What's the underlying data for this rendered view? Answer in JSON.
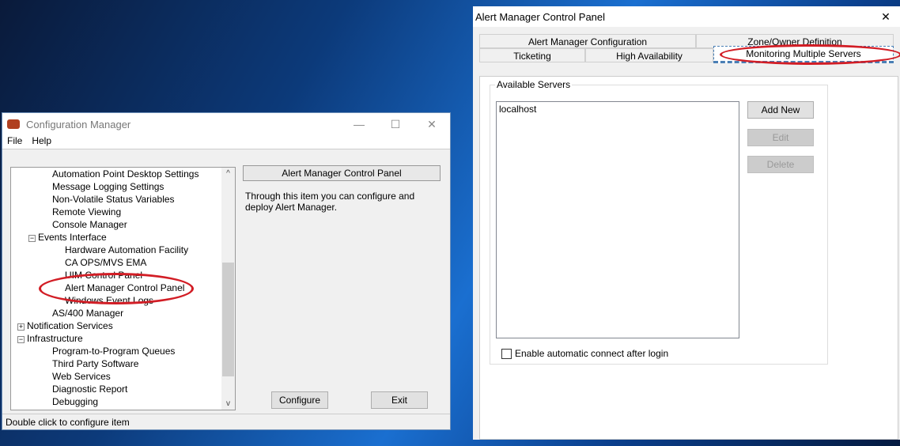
{
  "config_manager": {
    "title": "Configuration Manager",
    "menu": [
      "File",
      "Help"
    ],
    "tree": [
      {
        "label": "Automation Point Desktop Settings",
        "level": 2
      },
      {
        "label": "Message Logging Settings",
        "level": 2
      },
      {
        "label": "Non-Volatile Status Variables",
        "level": 2
      },
      {
        "label": "Remote Viewing",
        "level": 2
      },
      {
        "label": "Console Manager",
        "level": 2
      },
      {
        "label": "Events Interface",
        "level": 2,
        "expander": "−"
      },
      {
        "label": "Hardware Automation Facility",
        "level": 3
      },
      {
        "label": "CA OPS/MVS EMA",
        "level": 3
      },
      {
        "label": "UIM Control Panel",
        "level": 3
      },
      {
        "label": "Alert Manager Control Panel",
        "level": 3
      },
      {
        "label": "Windows Event Logs",
        "level": 3
      },
      {
        "label": "AS/400 Manager",
        "level": 2
      },
      {
        "label": "Notification Services",
        "level": 1,
        "expander": "+"
      },
      {
        "label": "Infrastructure",
        "level": 1,
        "expander": "−"
      },
      {
        "label": "Program-to-Program Queues",
        "level": 2
      },
      {
        "label": "Third Party Software",
        "level": 2
      },
      {
        "label": "Web Services",
        "level": 2
      },
      {
        "label": "Diagnostic Report",
        "level": 2
      },
      {
        "label": "Debugging",
        "level": 2
      }
    ],
    "info_title": "Alert Manager Control Panel",
    "info_text": "Through this item you can configure and deploy Alert Manager.",
    "configure": "Configure",
    "exit": "Exit",
    "status": "Double click to configure item"
  },
  "alert_manager": {
    "title": "Alert Manager Control Panel",
    "close": "✕",
    "tabs_row1": [
      "Alert Manager Configuration",
      "Zone/Owner Definition"
    ],
    "tabs_row2": [
      "Ticketing",
      "High Availability",
      "Monitoring Multiple Servers"
    ],
    "group_label": "Available Servers",
    "servers": [
      "localhost"
    ],
    "add_new": "Add New",
    "edit": "Edit",
    "delete": "Delete",
    "auto_connect": "Enable automatic connect after login"
  },
  "highlight_color": "#d21d25"
}
